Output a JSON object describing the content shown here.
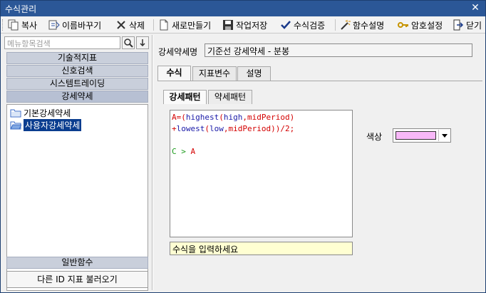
{
  "window": {
    "title": "수식관리"
  },
  "toolbar": {
    "items": [
      {
        "label": "복사"
      },
      {
        "label": "이름바꾸기"
      },
      {
        "label": "삭제"
      },
      {
        "label": "새로만들기"
      },
      {
        "label": "작업저장"
      },
      {
        "label": "수식검증"
      },
      {
        "label": "함수설명"
      },
      {
        "label": "암호설정"
      },
      {
        "label": "닫기"
      }
    ]
  },
  "sidebar": {
    "search_placeholder": "메뉴항목검색",
    "categories": [
      "기술적지표",
      "신호검색",
      "시스템트레이딩",
      "강세약세"
    ],
    "tree": [
      {
        "label": "기본강세약세",
        "selected": false
      },
      {
        "label": "사용자강세약세",
        "selected": true
      }
    ],
    "bottom_category": "일반함수",
    "load_button": "다른 ID 지표 불러오기"
  },
  "editor": {
    "name_label": "강세약세명",
    "name_value": "기준선 강세약세 - 분봉",
    "tabs": [
      "수식",
      "지표변수",
      "설명"
    ],
    "active_tab": "수식",
    "subtabs": [
      "강세패턴",
      "약세패턴"
    ],
    "active_subtab": "강세패턴",
    "formula_lines": [
      [
        {
          "t": "A=(",
          "c": "red"
        },
        {
          "t": "highest",
          "c": "blue"
        },
        {
          "t": "(",
          "c": "red"
        },
        {
          "t": "high",
          "c": "blue"
        },
        {
          "t": ",",
          "c": "red"
        },
        {
          "t": "midPeriod",
          "c": "red"
        },
        {
          "t": ")",
          "c": "red"
        }
      ],
      [
        {
          "t": "+",
          "c": "red"
        },
        {
          "t": "lowest",
          "c": "blue"
        },
        {
          "t": "(",
          "c": "red"
        },
        {
          "t": "low",
          "c": "blue"
        },
        {
          "t": ",",
          "c": "red"
        },
        {
          "t": "midPeriod",
          "c": "red"
        },
        {
          "t": "))/2;",
          "c": "red"
        }
      ],
      [],
      [
        {
          "t": "C > ",
          "c": "green"
        },
        {
          "t": "A",
          "c": "red"
        }
      ]
    ],
    "hint": "수식을 입력하세요",
    "color_label": "색상",
    "color_value": "#f8b8f8"
  }
}
